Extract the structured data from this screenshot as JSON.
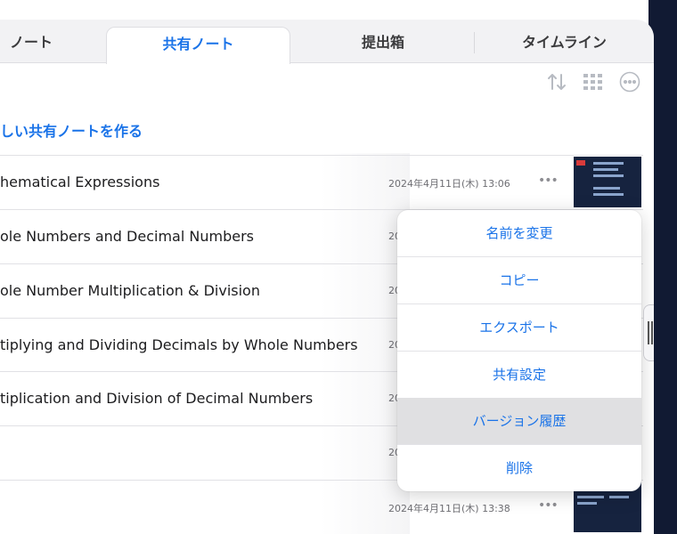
{
  "tabs": [
    {
      "label": "ノート"
    },
    {
      "label": "共有ノート"
    },
    {
      "label": "提出箱"
    },
    {
      "label": "タイムライン"
    }
  ],
  "toolbar": {
    "icons": [
      "sort-icon",
      "grid-icon",
      "more-icon"
    ]
  },
  "new_note_label": "しい共有ノートを作る",
  "rows": [
    {
      "title": "hematical Expressions",
      "date": "2024年4月11日(木) 13:06",
      "more": "•••"
    },
    {
      "title": "ole Numbers and Decimal Numbers",
      "date": "20",
      "more": ""
    },
    {
      "title": "ole Number Multiplication & Division",
      "date": "20",
      "more": ""
    },
    {
      "title": "tiplying and Dividing Decimals by Whole Numbers",
      "date": "20",
      "more": ""
    },
    {
      "title": "tiplication and Division of Decimal Numbers",
      "date": "20",
      "more": ""
    },
    {
      "title": "",
      "date": "20",
      "more": ""
    },
    {
      "title": "",
      "date": "2024年4月11日(木) 13:38",
      "more": "•••"
    }
  ],
  "context_menu": {
    "items": [
      {
        "label": "名前を変更"
      },
      {
        "label": "コピー"
      },
      {
        "label": "エクスポート"
      },
      {
        "label": "共有設定"
      },
      {
        "label": "バージョン履歴"
      },
      {
        "label": "削除"
      }
    ]
  },
  "colors": {
    "accent": "#1a73e8",
    "bezel": "#111a33",
    "highlight": "#e0e0e2"
  }
}
